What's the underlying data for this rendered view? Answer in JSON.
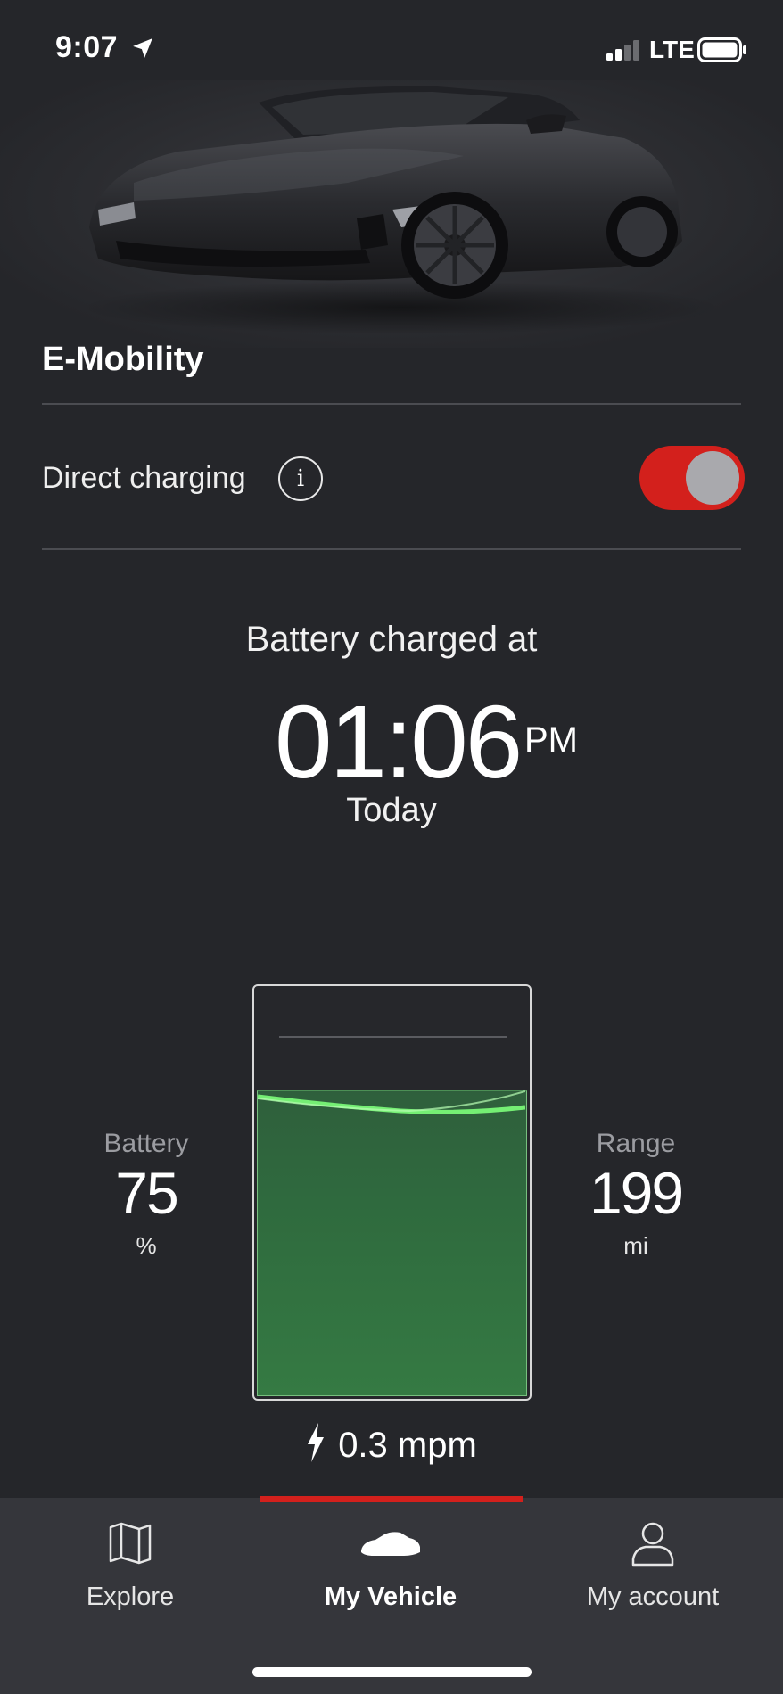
{
  "status_bar": {
    "time": "9:07",
    "network": "LTE",
    "location_icon": "location-arrow-icon",
    "signal_icon": "cellular-signal-icon",
    "battery_icon": "battery-icon"
  },
  "hero": {
    "image": "porsche-taycan-car-image"
  },
  "section": {
    "title": "E-Mobility"
  },
  "direct_charging": {
    "label": "Direct charging",
    "info_icon": "info-icon",
    "info_glyph": "i",
    "toggle_on": true,
    "toggle_color": "#d3201c"
  },
  "charge_status": {
    "label": "Battery charged at",
    "time": "01:06",
    "ampm": "PM",
    "day": "Today"
  },
  "battery": {
    "label": "Battery",
    "value": "75",
    "unit": "%",
    "fill_fraction": 0.75,
    "fill_color": "#357a43"
  },
  "range": {
    "label": "Range",
    "value": "199",
    "unit": "mi"
  },
  "charging_rate": {
    "icon": "lightning-bolt-icon",
    "value": "0.3 mpm"
  },
  "tabs": [
    {
      "label": "Explore",
      "icon": "map-icon",
      "active": false
    },
    {
      "label": "My Vehicle",
      "icon": "car-icon",
      "active": true
    },
    {
      "label": "My account",
      "icon": "user-icon",
      "active": false
    }
  ],
  "colors": {
    "background": "#25262a",
    "accent": "#d3201c",
    "tabbar": "#35363b"
  }
}
